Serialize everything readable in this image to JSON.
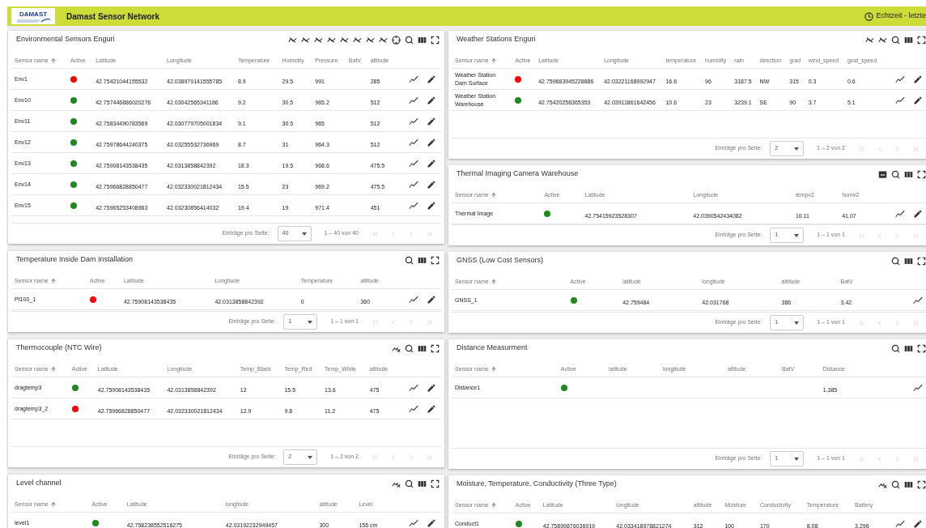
{
  "header": {
    "logo_text": "DAMAST",
    "title": "Damast Sensor Network",
    "realtime": "Echtzeit - letzte"
  },
  "left_panels": [
    {
      "title": "Environmental Sensors Enguri",
      "toolbar": [
        {
          "kind": "signal-off"
        },
        {
          "kind": "signal-off"
        },
        {
          "kind": "signal-off"
        },
        {
          "kind": "signal-off"
        },
        {
          "kind": "signal-off"
        },
        {
          "kind": "signal-off"
        },
        {
          "kind": "signal-off"
        },
        {
          "kind": "signal-off"
        },
        {
          "kind": "locate"
        },
        {
          "kind": "search"
        },
        {
          "kind": "columns"
        },
        {
          "kind": "fullscreen"
        }
      ],
      "columns": [
        {
          "label": "Sensor name",
          "sorted": true
        },
        {
          "label": "Active",
          "sorted": false
        },
        {
          "label": "Latitude",
          "sorted": false
        },
        {
          "label": "Longitude",
          "sorted": false
        },
        {
          "label": "Temperature",
          "sorted": false
        },
        {
          "label": "Humidity",
          "sorted": false
        },
        {
          "label": "Pressure",
          "sorted": false
        },
        {
          "label": "BatV",
          "sorted": false
        },
        {
          "label": "altitude",
          "sorted": false
        }
      ],
      "row_actions": [
        {
          "kind": "chart"
        },
        {
          "kind": "edit"
        }
      ],
      "rows": [
        {
          "name": "Env1",
          "active": false,
          "values": [
            {
              "kind": "text",
              "text": "42.75421044155532"
            },
            {
              "kind": "text",
              "text": "42.038979141555785"
            },
            {
              "kind": "text",
              "text": "8.9"
            },
            {
              "kind": "text",
              "text": "29.5"
            },
            {
              "kind": "text",
              "text": "991"
            },
            {
              "kind": "blank"
            },
            {
              "kind": "text",
              "text": "285"
            }
          ]
        },
        {
          "name": "Env10",
          "active": true,
          "values": [
            {
              "kind": "text",
              "text": "42.757446886020276"
            },
            {
              "kind": "text",
              "text": "42.03042565341186"
            },
            {
              "kind": "text",
              "text": "9.2"
            },
            {
              "kind": "text",
              "text": "30.5"
            },
            {
              "kind": "text",
              "text": "965.2"
            },
            {
              "kind": "blank"
            },
            {
              "kind": "text",
              "text": "512"
            }
          ]
        },
        {
          "name": "Env11",
          "active": true,
          "values": [
            {
              "kind": "text",
              "text": "42.75834490783569"
            },
            {
              "kind": "text",
              "text": "42.030779705001834"
            },
            {
              "kind": "text",
              "text": "9.1"
            },
            {
              "kind": "text",
              "text": "30.5"
            },
            {
              "kind": "text",
              "text": "965"
            },
            {
              "kind": "blank"
            },
            {
              "kind": "text",
              "text": "512"
            }
          ]
        },
        {
          "name": "Env12",
          "active": true,
          "values": [
            {
              "kind": "text",
              "text": "42.75978644240375"
            },
            {
              "kind": "text",
              "text": "42.03255532736969"
            },
            {
              "kind": "text",
              "text": "8.7"
            },
            {
              "kind": "text",
              "text": "31"
            },
            {
              "kind": "text",
              "text": "964.3"
            },
            {
              "kind": "blank"
            },
            {
              "kind": "text",
              "text": "512"
            }
          ]
        },
        {
          "name": "Env13",
          "active": true,
          "values": [
            {
              "kind": "text",
              "text": "42.75908143538435"
            },
            {
              "kind": "text",
              "text": "42.0313858842392"
            },
            {
              "kind": "text",
              "text": "18.3"
            },
            {
              "kind": "text",
              "text": "19.5"
            },
            {
              "kind": "text",
              "text": "968.6"
            },
            {
              "kind": "blank"
            },
            {
              "kind": "text",
              "text": "475.5"
            }
          ]
        },
        {
          "name": "Env14",
          "active": true,
          "values": [
            {
              "kind": "text",
              "text": "42.75966828850477"
            },
            {
              "kind": "text",
              "text": "42.032330021812434"
            },
            {
              "kind": "text",
              "text": "15.5"
            },
            {
              "kind": "text",
              "text": "23"
            },
            {
              "kind": "text",
              "text": "969.2"
            },
            {
              "kind": "blank"
            },
            {
              "kind": "text",
              "text": "475.5"
            }
          ]
        },
        {
          "name": "Env15",
          "active": true,
          "values": [
            {
              "kind": "text",
              "text": "42.75965253408963"
            },
            {
              "kind": "text",
              "text": "42.03230856414032"
            },
            {
              "kind": "text",
              "text": "19.4"
            },
            {
              "kind": "text",
              "text": "19"
            },
            {
              "kind": "text",
              "text": "971.4"
            },
            {
              "kind": "blank"
            },
            {
              "kind": "text",
              "text": "451"
            }
          ]
        }
      ],
      "pagination": {
        "label": "Einträge pro Seite:",
        "per_page": "40",
        "range": "1 – 40 von 40",
        "nav": [
          {
            "kind": "first",
            "disabled": true
          },
          {
            "kind": "prev",
            "disabled": true
          },
          {
            "kind": "next",
            "disabled": true
          },
          {
            "kind": "last",
            "disabled": true
          }
        ]
      }
    },
    {
      "title": "Temperature Inside Dam Installation",
      "toolbar": [
        {
          "kind": "search"
        },
        {
          "kind": "columns"
        },
        {
          "kind": "fullscreen"
        }
      ],
      "columns": [
        {
          "label": "Sensor name",
          "sorted": true
        },
        {
          "label": "Active",
          "sorted": false
        },
        {
          "label": "Latitude",
          "sorted": false
        },
        {
          "label": "Longitude",
          "sorted": false
        },
        {
          "label": "Temperature",
          "sorted": false
        },
        {
          "label": "altitude",
          "sorted": false
        }
      ],
      "row_actions": [
        {
          "kind": "chart"
        },
        {
          "kind": "edit"
        }
      ],
      "rows": [
        {
          "name": "Pt100_1",
          "active": false,
          "values": [
            {
              "kind": "text",
              "text": "42.75908143538435"
            },
            {
              "kind": "text",
              "text": "42.0313858842392"
            },
            {
              "kind": "text",
              "text": "0"
            },
            {
              "kind": "text",
              "text": "360"
            }
          ]
        }
      ],
      "pagination": {
        "label": "Einträge pro Seite:",
        "per_page": "1",
        "range": "1 – 1 von 1",
        "nav": [
          {
            "kind": "first",
            "disabled": true
          },
          {
            "kind": "prev",
            "disabled": true
          },
          {
            "kind": "next",
            "disabled": true
          },
          {
            "kind": "last",
            "disabled": true
          }
        ]
      }
    },
    {
      "title": "Thermocouple (NTC Wire)",
      "toolbar": [
        {
          "kind": "chart-off"
        },
        {
          "kind": "search"
        },
        {
          "kind": "columns"
        },
        {
          "kind": "fullscreen"
        }
      ],
      "columns": [
        {
          "label": "Sensor name",
          "sorted": true
        },
        {
          "label": "Active",
          "sorted": false
        },
        {
          "label": "Latitude",
          "sorted": false
        },
        {
          "label": "Longitude",
          "sorted": false
        },
        {
          "label": "Temp_Black",
          "sorted": false
        },
        {
          "label": "Temp_Red",
          "sorted": false
        },
        {
          "label": "Temp_White",
          "sorted": false
        },
        {
          "label": "altitude",
          "sorted": false
        }
      ],
      "row_actions": [
        {
          "kind": "chart"
        },
        {
          "kind": "edit"
        }
      ],
      "rows": [
        {
          "name": "dragtemp3",
          "active": true,
          "values": [
            {
              "kind": "text",
              "text": "42.75908143538435"
            },
            {
              "kind": "text",
              "text": "42.0313858842392"
            },
            {
              "kind": "text",
              "text": "12"
            },
            {
              "kind": "text",
              "text": "15.5"
            },
            {
              "kind": "text",
              "text": "13.6"
            },
            {
              "kind": "text",
              "text": "475"
            }
          ]
        },
        {
          "name": "dragtemp3_2",
          "active": false,
          "values": [
            {
              "kind": "text",
              "text": "42.75966828850477"
            },
            {
              "kind": "text",
              "text": "42.032330021812434"
            },
            {
              "kind": "text",
              "text": "12.9"
            },
            {
              "kind": "text",
              "text": "9.8"
            },
            {
              "kind": "text",
              "text": "11.2"
            },
            {
              "kind": "text",
              "text": "475"
            }
          ]
        }
      ],
      "pagination": {
        "label": "Einträge pro Seite:",
        "per_page": "2",
        "range": "1 – 2 von 2",
        "nav": [
          {
            "kind": "first",
            "disabled": true
          },
          {
            "kind": "prev",
            "disabled": true
          },
          {
            "kind": "next",
            "disabled": true
          },
          {
            "kind": "last",
            "disabled": true
          }
        ]
      }
    },
    {
      "title": "Level channel",
      "toolbar": [
        {
          "kind": "chart-off"
        },
        {
          "kind": "search"
        },
        {
          "kind": "columns"
        },
        {
          "kind": "fullscreen"
        }
      ],
      "columns": [
        {
          "label": "Sensor name",
          "sorted": true
        },
        {
          "label": "Active",
          "sorted": false
        },
        {
          "label": "Latitude",
          "sorted": false
        },
        {
          "label": "longitude",
          "sorted": false
        },
        {
          "label": "altitude",
          "sorted": false
        },
        {
          "label": "Level",
          "sorted": false
        }
      ],
      "row_actions": [
        {
          "kind": "chart"
        },
        {
          "kind": "edit"
        }
      ],
      "rows": [
        {
          "name": "level1",
          "active": true,
          "values": [
            {
              "kind": "text",
              "text": "42.758238552516275"
            },
            {
              "kind": "text",
              "text": "42.03192232949457"
            },
            {
              "kind": "text",
              "text": "300"
            },
            {
              "kind": "text",
              "text": "156 cm"
            }
          ]
        }
      ]
    }
  ],
  "right_panels": [
    {
      "title": "Weather Stations Enguri",
      "toolbar": [
        {
          "kind": "signal-off"
        },
        {
          "kind": "signal-off"
        },
        {
          "kind": "search"
        },
        {
          "kind": "columns"
        },
        {
          "kind": "fullscreen"
        }
      ],
      "columns": [
        {
          "label": "Sensor name",
          "sorted": true
        },
        {
          "label": "Active",
          "sorted": false
        },
        {
          "label": "Latitude",
          "sorted": false
        },
        {
          "label": "Longitude",
          "sorted": false
        },
        {
          "label": "temperature",
          "sorted": false
        },
        {
          "label": "humidity",
          "sorted": false
        },
        {
          "label": "rain",
          "sorted": false
        },
        {
          "label": "direction",
          "sorted": false
        },
        {
          "label": "grad",
          "sorted": false
        },
        {
          "label": "wind_speed",
          "sorted": false
        },
        {
          "label": "gust_speed",
          "sorted": false
        }
      ],
      "row_actions": [
        {
          "kind": "chart"
        },
        {
          "kind": "edit"
        }
      ],
      "rows": [
        {
          "name": "Weather Station Dam Surface",
          "active": false,
          "values": [
            {
              "kind": "text",
              "text": "42.759683945228886"
            },
            {
              "kind": "text",
              "text": "42.03221168992947"
            },
            {
              "kind": "text",
              "text": "16.6"
            },
            {
              "kind": "text",
              "text": "96"
            },
            {
              "kind": "text",
              "text": "3187.5"
            },
            {
              "kind": "text",
              "text": "NW"
            },
            {
              "kind": "text",
              "text": "315"
            },
            {
              "kind": "text",
              "text": "0.3"
            },
            {
              "kind": "text",
              "text": "0.6"
            }
          ]
        },
        {
          "name": "Weather Station Warehouse",
          "active": true,
          "values": [
            {
              "kind": "text",
              "text": "42.75420256365353"
            },
            {
              "kind": "text",
              "text": "42.03911861642456"
            },
            {
              "kind": "text",
              "text": "10.6"
            },
            {
              "kind": "text",
              "text": "23"
            },
            {
              "kind": "text",
              "text": "3239.1"
            },
            {
              "kind": "text",
              "text": "SE"
            },
            {
              "kind": "text",
              "text": "90"
            },
            {
              "kind": "text",
              "text": "3.7"
            },
            {
              "kind": "text",
              "text": "5.1"
            }
          ]
        }
      ],
      "pagination": {
        "label": "Einträge pro Seite:",
        "per_page": "2",
        "range": "1 – 2 von 2",
        "nav": [
          {
            "kind": "first",
            "disabled": true
          },
          {
            "kind": "prev",
            "disabled": true
          },
          {
            "kind": "next",
            "disabled": true
          },
          {
            "kind": "last",
            "disabled": true
          }
        ]
      }
    },
    {
      "title": "Thermal Imaging Camera Warehouse",
      "toolbar": [
        {
          "kind": "message"
        },
        {
          "kind": "search"
        },
        {
          "kind": "columns"
        },
        {
          "kind": "fullscreen"
        }
      ],
      "columns": [
        {
          "label": "Sensor name",
          "sorted": true
        },
        {
          "label": "Active",
          "sorted": false
        },
        {
          "label": "Latitude",
          "sorted": false
        },
        {
          "label": "Longitude",
          "sorted": false
        },
        {
          "label": "tempv2",
          "sorted": false
        },
        {
          "label": "humv2",
          "sorted": false
        }
      ],
      "row_actions": [
        {
          "kind": "chart"
        },
        {
          "kind": "edit"
        }
      ],
      "rows": [
        {
          "name": "Thermal Image",
          "active": true,
          "values": [
            {
              "kind": "text",
              "text": "42.75415923528307"
            },
            {
              "kind": "text",
              "text": "42.0390542434082"
            },
            {
              "kind": "text",
              "text": "10.11"
            },
            {
              "kind": "text",
              "text": "41.07"
            }
          ]
        }
      ],
      "pagination": {
        "label": "Einträge pro Seite:",
        "per_page": "1",
        "range": "1 – 1 von 1",
        "nav": [
          {
            "kind": "first",
            "disabled": true
          },
          {
            "kind": "prev",
            "disabled": true
          },
          {
            "kind": "next",
            "disabled": true
          },
          {
            "kind": "last",
            "disabled": true
          }
        ]
      }
    },
    {
      "title": "GNSS (Low Cost Sensors)",
      "toolbar": [
        {
          "kind": "search"
        },
        {
          "kind": "columns"
        },
        {
          "kind": "fullscreen"
        }
      ],
      "columns": [
        {
          "label": "Sensor name",
          "sorted": true
        },
        {
          "label": "Active",
          "sorted": false
        },
        {
          "label": "latitude",
          "sorted": false
        },
        {
          "label": "longitude",
          "sorted": false
        },
        {
          "label": "altitude",
          "sorted": false
        },
        {
          "label": "BatV",
          "sorted": false
        }
      ],
      "row_actions": [
        {
          "kind": "chart"
        }
      ],
      "rows": [
        {
          "name": "GNSS_1",
          "active": true,
          "values": [
            {
              "kind": "text",
              "text": "42.759484"
            },
            {
              "kind": "text",
              "text": "42.031768"
            },
            {
              "kind": "text",
              "text": "386"
            },
            {
              "kind": "text",
              "text": "3.42"
            }
          ]
        }
      ],
      "pagination": {
        "label": "Einträge pro Seite:",
        "per_page": "1",
        "range": "1 – 1 von 1",
        "nav": [
          {
            "kind": "first",
            "disabled": true
          },
          {
            "kind": "prev",
            "disabled": true
          },
          {
            "kind": "next",
            "disabled": true
          },
          {
            "kind": "last",
            "disabled": true
          }
        ]
      }
    },
    {
      "title": "Distance Measurment",
      "toolbar": [
        {
          "kind": "search"
        },
        {
          "kind": "columns"
        },
        {
          "kind": "fullscreen"
        }
      ],
      "columns": [
        {
          "label": "Sensor name",
          "sorted": true
        },
        {
          "label": "Active",
          "sorted": false
        },
        {
          "label": "latitude",
          "sorted": false
        },
        {
          "label": "longitude",
          "sorted": false
        },
        {
          "label": "altitude",
          "sorted": false
        },
        {
          "label": "BatV",
          "sorted": false
        },
        {
          "label": "Distance",
          "sorted": false
        }
      ],
      "row_actions": [
        {
          "kind": "chart"
        }
      ],
      "rows": [
        {
          "name": "Distance1",
          "active": true,
          "values": [
            {
              "kind": "blank"
            },
            {
              "kind": "blank"
            },
            {
              "kind": "blank"
            },
            {
              "kind": "blank"
            },
            {
              "kind": "text",
              "text": "1.385"
            }
          ]
        }
      ],
      "pagination": {
        "label": "Einträge pro Seite:",
        "per_page": "1",
        "range": "1 – 1 von 1",
        "nav": [
          {
            "kind": "first",
            "disabled": true
          },
          {
            "kind": "prev",
            "disabled": true
          },
          {
            "kind": "next",
            "disabled": true
          },
          {
            "kind": "last",
            "disabled": true
          }
        ]
      }
    },
    {
      "title": "Moisture, Temperature, Conductivity (Three Type)",
      "toolbar": [
        {
          "kind": "chart-off"
        },
        {
          "kind": "search"
        },
        {
          "kind": "columns"
        },
        {
          "kind": "fullscreen"
        }
      ],
      "columns": [
        {
          "label": "Sensor name",
          "sorted": true
        },
        {
          "label": "Active",
          "sorted": false
        },
        {
          "label": "Latitude",
          "sorted": false
        },
        {
          "label": "longitude",
          "sorted": false
        },
        {
          "label": "altitude",
          "sorted": false
        },
        {
          "label": "Moisture",
          "sorted": false
        },
        {
          "label": "Conductivity",
          "sorted": false
        },
        {
          "label": "Temperature",
          "sorted": false
        },
        {
          "label": "Battery",
          "sorted": false
        }
      ],
      "row_actions": [
        {
          "kind": "chart"
        },
        {
          "kind": "edit"
        }
      ],
      "rows": [
        {
          "name": "Conduct1",
          "active": true,
          "values": [
            {
              "kind": "text",
              "text": "42.75899876036919"
            },
            {
              "kind": "text",
              "text": "42.033418978821274"
            },
            {
              "kind": "text",
              "text": "312"
            },
            {
              "kind": "text",
              "text": "100"
            },
            {
              "kind": "text",
              "text": "170"
            },
            {
              "kind": "text",
              "text": "8.08"
            },
            {
              "kind": "text",
              "text": "3.296"
            }
          ]
        }
      ]
    }
  ]
}
